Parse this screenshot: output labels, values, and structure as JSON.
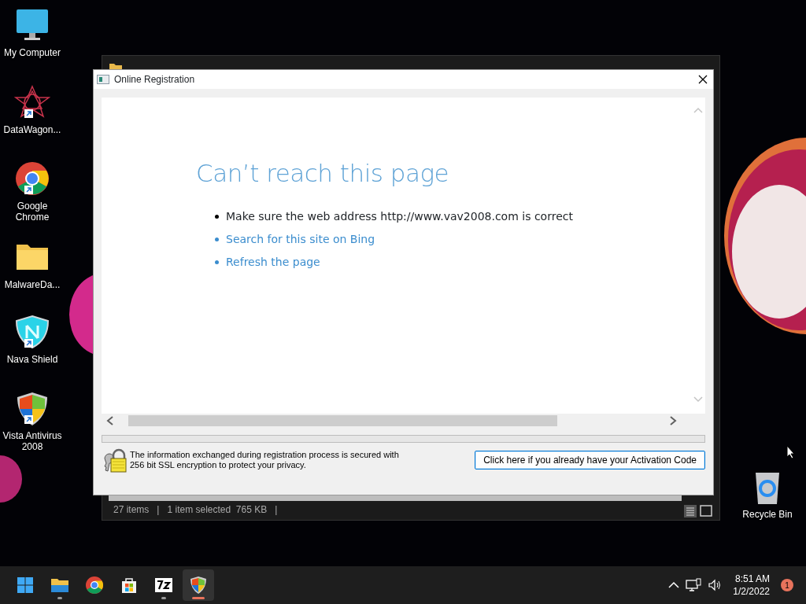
{
  "desktop_icons": [
    {
      "label": "My Computer",
      "kind": "computer",
      "shortcut": false
    },
    {
      "label": "DataWagon...",
      "kind": "star",
      "shortcut": true
    },
    {
      "label": "Google Chrome",
      "kind": "browser",
      "shortcut": true
    },
    {
      "label": "MalwareDa...",
      "kind": "folder",
      "shortcut": false
    },
    {
      "label": "Nava Shield",
      "kind": "shield",
      "shortcut": true
    },
    {
      "label": "Vista Antivirus 2008",
      "kind": "security",
      "shortcut": true
    },
    {
      "label": "Recycle Bin",
      "kind": "bin",
      "shortcut": false
    }
  ],
  "background_window": {
    "status_bar": [
      "27 items",
      "|",
      "1 item selected  765 KB",
      "|"
    ]
  },
  "dialog": {
    "title": "Online Registration",
    "heading": "Can’t reach this page",
    "bullets": [
      {
        "kind": "text",
        "text": "Make sure the web address http://www.vav2008.com is correct"
      },
      {
        "kind": "link",
        "text": "Search for this site on Bing"
      },
      {
        "kind": "link",
        "text": "Refresh the page"
      }
    ],
    "progress": {
      "level": 0
    },
    "security_note": "The information exchanged during registration process is secured with 256 bit SSL encryption to protect your privacy.",
    "activation_button": "Click here if you already have your Activation Code"
  },
  "taskbar": {
    "apps": [
      {
        "kind": "start",
        "selected": false,
        "running": false
      },
      {
        "kind": "explorer",
        "selected": false,
        "running": true
      },
      {
        "kind": "browser",
        "selected": false,
        "running": false
      },
      {
        "kind": "store",
        "selected": false,
        "running": false
      },
      {
        "kind": "archive",
        "selected": false,
        "running": true
      },
      {
        "kind": "security",
        "selected": true,
        "running": true
      }
    ],
    "time": "8:51 AM",
    "date": "1/2/2022",
    "notification_count": "1"
  }
}
